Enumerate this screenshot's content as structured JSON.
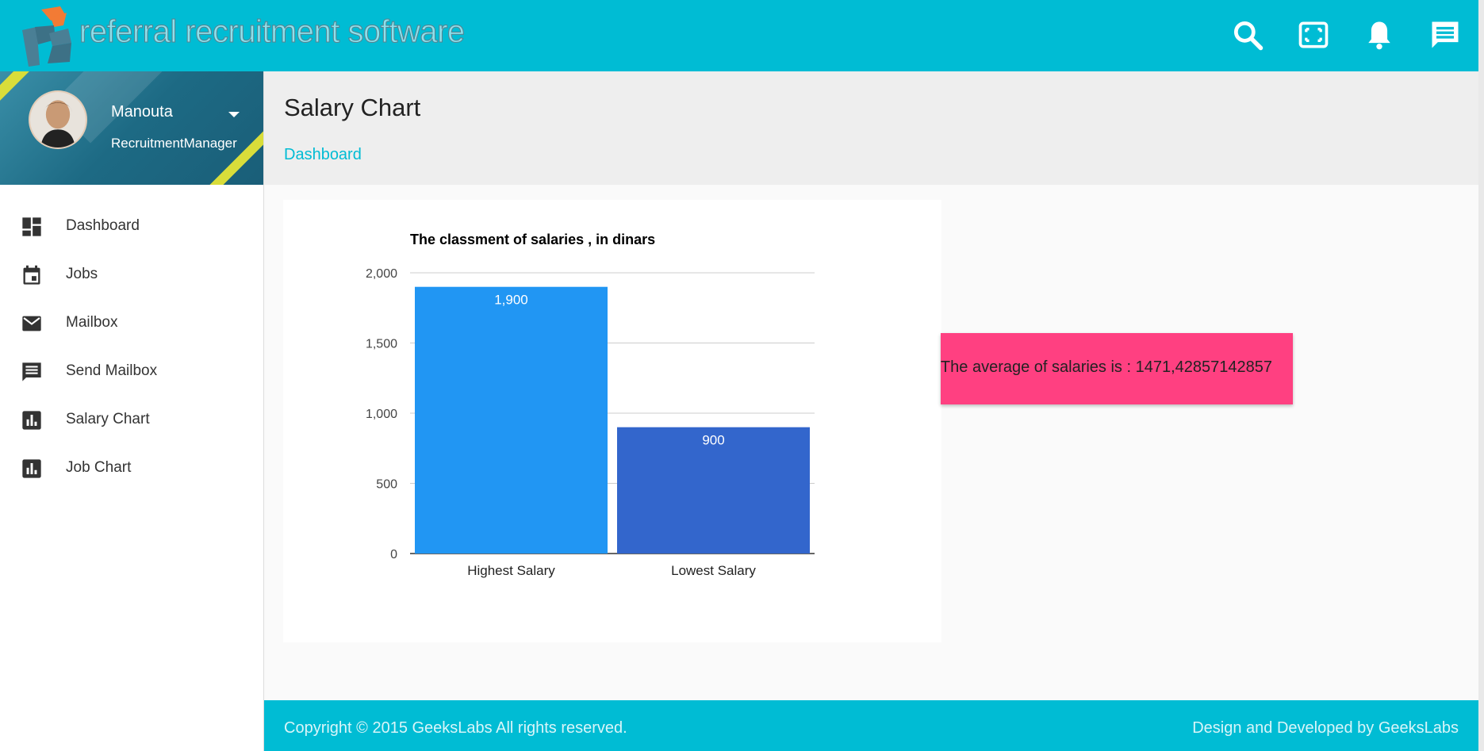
{
  "header": {
    "brand_text": "referral recruitment software",
    "icons": [
      "search-icon",
      "fullscreen-icon",
      "notifications-icon",
      "chat-icon"
    ]
  },
  "profile": {
    "name": "Manouta",
    "role": "RecruitmentManager"
  },
  "sidebar": {
    "items": [
      {
        "label": "Dashboard",
        "icon": "dashboard-icon"
      },
      {
        "label": "Jobs",
        "icon": "calendar-icon"
      },
      {
        "label": "Mailbox",
        "icon": "mail-icon"
      },
      {
        "label": "Send Mailbox",
        "icon": "message-icon"
      },
      {
        "label": "Salary Chart",
        "icon": "bar-chart-icon"
      },
      {
        "label": "Job Chart",
        "icon": "bar-chart-icon"
      }
    ]
  },
  "page": {
    "title": "Salary Chart",
    "breadcrumb": "Dashboard"
  },
  "average_box": {
    "text": "The average of salaries is : 1471,42857142857"
  },
  "footer": {
    "left": "Copyright © 2015 GeeksLabs All rights reserved.",
    "right": "Design and Developed by GeeksLabs"
  },
  "colors": {
    "header": "#00bcd4",
    "accent_pink": "#ff4081",
    "bar_highest": "#2196f3",
    "bar_lowest": "#3366cc"
  },
  "chart_data": {
    "type": "bar",
    "title": "The classment of salaries , in dinars",
    "categories": [
      "Highest Salary",
      "Lowest Salary"
    ],
    "values": [
      1900,
      900
    ],
    "value_labels": [
      "1,900",
      "900"
    ],
    "bar_colors": [
      "#2196f3",
      "#3366cc"
    ],
    "ylim": [
      0,
      2000
    ],
    "yticks": [
      0,
      500,
      1000,
      1500,
      2000
    ],
    "ytick_labels": [
      "0",
      "500",
      "1,000",
      "1,500",
      "2,000"
    ],
    "grid": true,
    "legend": "none"
  }
}
